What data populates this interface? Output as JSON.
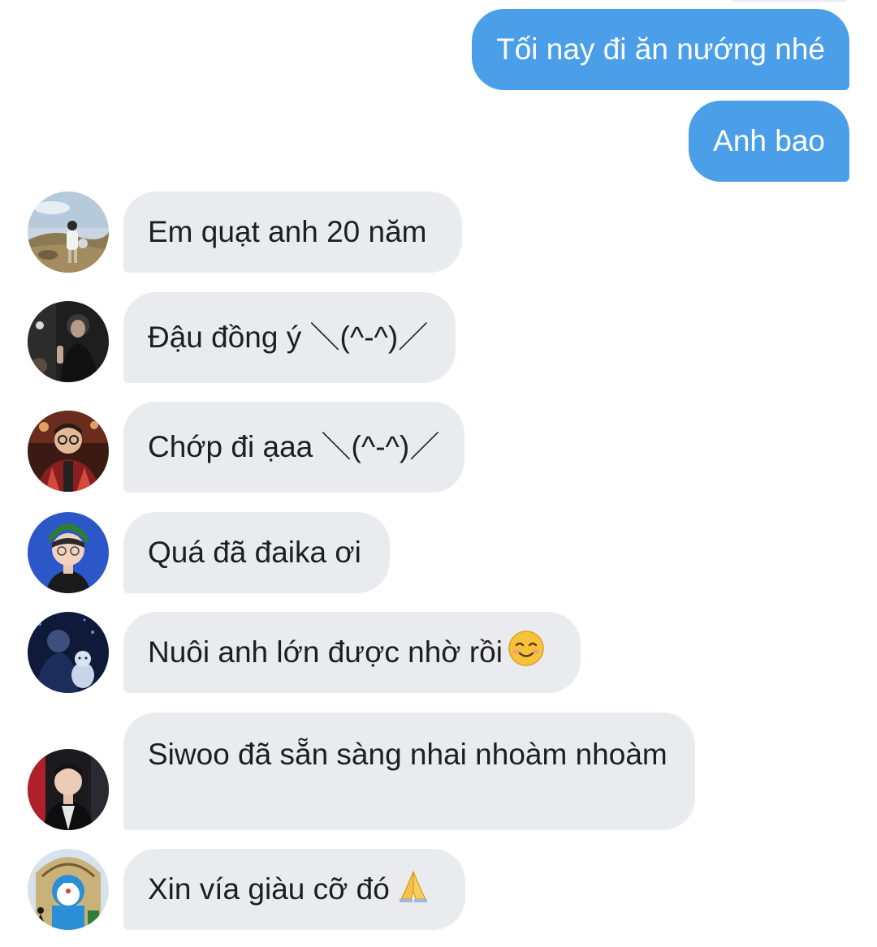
{
  "conversation": {
    "outgoing": [
      {
        "text": "Tối nay đi ăn nướng nhé"
      },
      {
        "text": "Anh bao"
      }
    ],
    "incoming": [
      {
        "text": "Em quạt anh 20 năm",
        "avatar": "avatar-photo-field"
      },
      {
        "text": "Đậu đồng ý ＼(^-^)／",
        "avatar": "avatar-photo-dark"
      },
      {
        "text": "Chớp đi ạaa ＼(^-^)／",
        "avatar": "avatar-photo-glasses"
      },
      {
        "text": "Quá đã đaika ơi",
        "avatar": "avatar-photo-green-hat"
      },
      {
        "text": "Nuôi anh lớn được nhờ rồi",
        "emoji": "smiling-face-emoji",
        "avatar": "avatar-photo-night"
      },
      {
        "text": "Siwoo đã sẵn sàng nhai nhoàm nhoàm",
        "avatar": "avatar-photo-coat"
      },
      {
        "text": "Xin vía giàu cỡ đó",
        "emoji": "folded-hands-emoji",
        "avatar": "avatar-photo-doraemon"
      }
    ]
  },
  "colors": {
    "outgoing_bubble": "#4a9fe8",
    "incoming_bubble": "#e9ebef",
    "text_dark": "#1c1e21"
  }
}
